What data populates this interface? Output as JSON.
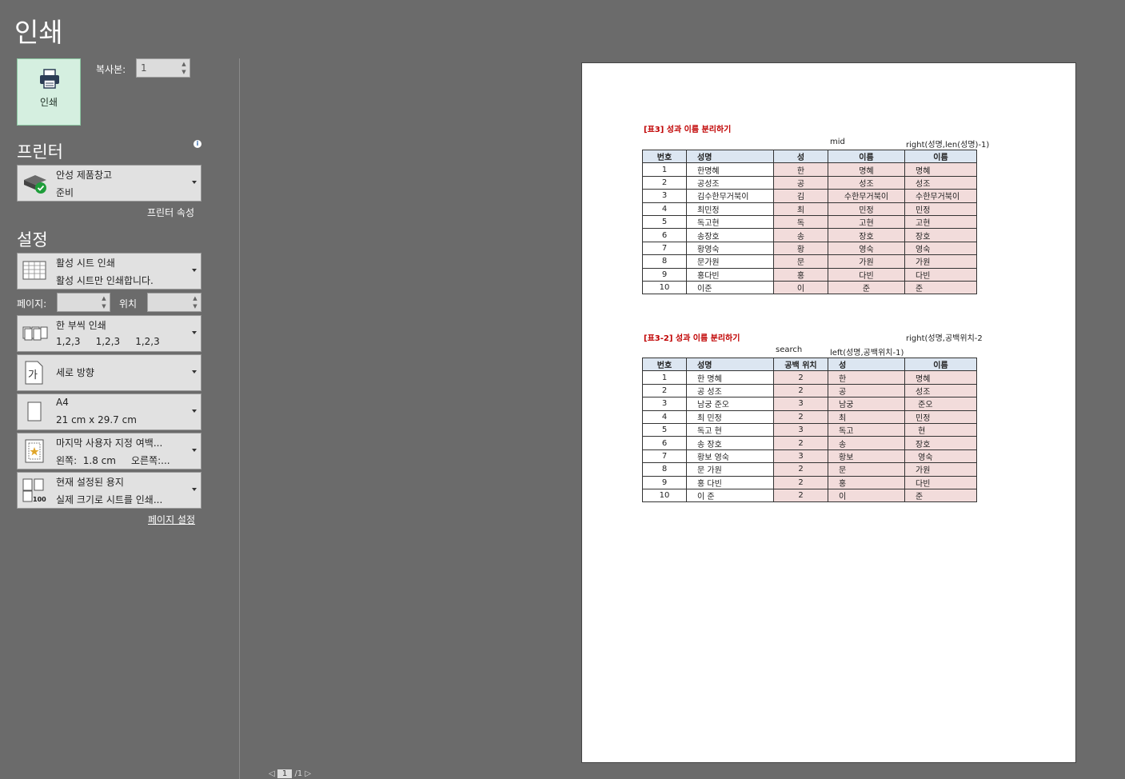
{
  "title": "인쇄",
  "print_button": {
    "label": "인쇄"
  },
  "copies": {
    "label": "복사본:",
    "value": "1"
  },
  "printer": {
    "heading": "프린터",
    "name": "안성 제품창고",
    "status": "준비",
    "properties_link": "프린터 속성"
  },
  "settings": {
    "heading": "설정",
    "scope": {
      "line1": "활성 시트 인쇄",
      "line2": "활성 시트만 인쇄합니다."
    },
    "pages_label": "페이지:",
    "pages_value": "",
    "to_label": "위치",
    "to_value": "",
    "collate": {
      "line1": "한 부씩 인쇄",
      "line2": "1,2,3     1,2,3     1,2,3"
    },
    "orientation": {
      "line1": "세로 방향"
    },
    "paper": {
      "line1": "A4",
      "line2": "21 cm x 29.7 cm"
    },
    "margins": {
      "line1": "마지막 사용자 지정 여백...",
      "line2": "왼쪽:  1.8 cm     오른쪽:..."
    },
    "scaling": {
      "line1": "현재 설정된 용지",
      "line2": "실제 크기로 시트를 인쇄..."
    },
    "page_setup_link": "페이지 설정"
  },
  "preview": {
    "table1": {
      "title": "[표3] 성과 이름 분리하기",
      "note_mid": "mid",
      "note_right": "right(성명,len(성명)-1)",
      "headers": [
        "번호",
        "성명",
        "성",
        "이름",
        "이름"
      ],
      "rows": [
        [
          "1",
          "한명혜",
          "한",
          "명혜",
          "명혜"
        ],
        [
          "2",
          "공성조",
          "공",
          "성조",
          "성조"
        ],
        [
          "3",
          "김수한무거북이",
          "김",
          "수한무거북이",
          "수한무거북이"
        ],
        [
          "4",
          "최민정",
          "최",
          "민정",
          "민정"
        ],
        [
          "5",
          "독고현",
          "독",
          "고현",
          "고현"
        ],
        [
          "6",
          "송장호",
          "송",
          "장호",
          "장호"
        ],
        [
          "7",
          "황영숙",
          "황",
          "영숙",
          "영숙"
        ],
        [
          "8",
          "문가원",
          "문",
          "가원",
          "가원"
        ],
        [
          "9",
          "홍다빈",
          "홍",
          "다빈",
          "다빈"
        ],
        [
          "10",
          "이준",
          "이",
          "준",
          "준"
        ]
      ]
    },
    "table2": {
      "title": "[표3-2] 성과 이름 분리하기",
      "note_right": "right(성명,공백위치-2",
      "note_search": "search",
      "note_left": "left(성명,공백위치-1)",
      "headers": [
        "번호",
        "성명",
        "공백 위치",
        "성",
        "이름"
      ],
      "rows": [
        [
          "1",
          "한 명혜",
          "2",
          "한",
          "명혜"
        ],
        [
          "2",
          "공 성조",
          "2",
          "공",
          "성조"
        ],
        [
          "3",
          "남궁 준오",
          "3",
          "남궁",
          " 준오"
        ],
        [
          "4",
          "최 민정",
          "2",
          "최",
          "민정"
        ],
        [
          "5",
          "독고 현",
          "3",
          "독고",
          " 현"
        ],
        [
          "6",
          "송 장호",
          "2",
          "송",
          "장호"
        ],
        [
          "7",
          "황보 영숙",
          "3",
          "황보",
          " 영숙"
        ],
        [
          "8",
          "문 가원",
          "2",
          "문",
          "가원"
        ],
        [
          "9",
          "홍 다빈",
          "2",
          "홍",
          "다빈"
        ],
        [
          "10",
          "이 준",
          "2",
          "이",
          "준"
        ]
      ]
    }
  },
  "pager": {
    "current": "1",
    "total": "/1"
  }
}
